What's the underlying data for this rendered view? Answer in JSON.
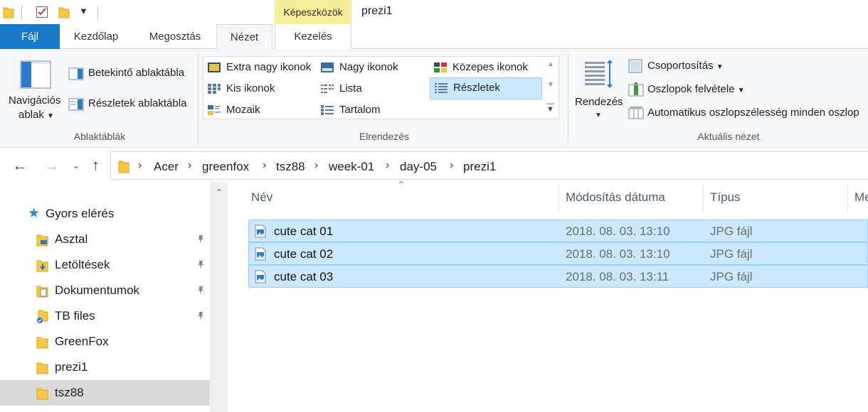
{
  "window": {
    "title": "prezi1",
    "context_tab": "Képeszközök"
  },
  "tabs": {
    "file": "Fájl",
    "home": "Kezdőlap",
    "share": "Megosztás",
    "view": "Nézet",
    "manage": "Kezelés"
  },
  "ribbon": {
    "panes": {
      "nav_pane_line1": "Navigációs",
      "nav_pane_line2": "ablak",
      "preview_pane": "Betekintő ablaktábla",
      "details_pane": "Részletek ablaktábla",
      "group_label": "Ablaktáblák"
    },
    "layout": {
      "items": [
        "Extra nagy ikonok",
        "Nagy ikonok",
        "Közepes ikonok",
        "Kis ikonok",
        "Lista",
        "Részletek",
        "Mozaik",
        "Tartalom"
      ],
      "selected": "Részletek",
      "group_label": "Elrendezés"
    },
    "current_view": {
      "sort_by": "Rendezés",
      "group_by": "Csoportosítás",
      "add_columns": "Oszlopok felvétele",
      "autosize": "Automatikus oszlopszélesség minden oszlop",
      "group_label": "Aktuális nézet"
    }
  },
  "address": {
    "breadcrumbs": [
      "Acer",
      "greenfox",
      "tsz88",
      "week-01",
      "day-05",
      "prezi1"
    ]
  },
  "nav": {
    "quick_access": "Gyors elérés",
    "items": [
      {
        "label": "Asztal",
        "pinned": true
      },
      {
        "label": "Letöltések",
        "pinned": true
      },
      {
        "label": "Dokumentumok",
        "pinned": true
      },
      {
        "label": "TB files",
        "pinned": true
      },
      {
        "label": "GreenFox",
        "pinned": false
      },
      {
        "label": "prezi1",
        "pinned": false
      },
      {
        "label": "tsz88",
        "pinned": false
      }
    ],
    "selected": "tsz88"
  },
  "files": {
    "columns": [
      "Név",
      "Módosítás dátuma",
      "Típus",
      "Me"
    ],
    "rows": [
      {
        "name": "cute cat 01",
        "modified": "2018. 08. 03. 13:10",
        "type": "JPG fájl"
      },
      {
        "name": "cute cat 02",
        "modified": "2018. 08. 03. 13:10",
        "type": "JPG fájl"
      },
      {
        "name": "cute cat 03",
        "modified": "2018. 08. 03. 13:11",
        "type": "JPG fájl"
      }
    ]
  },
  "colors": {
    "file_tab": "#1979ca",
    "context_tab": "#f4ee9a",
    "selection": "#cce8ff",
    "selection_border": "#99d1ff",
    "folder": "#f5c842"
  }
}
